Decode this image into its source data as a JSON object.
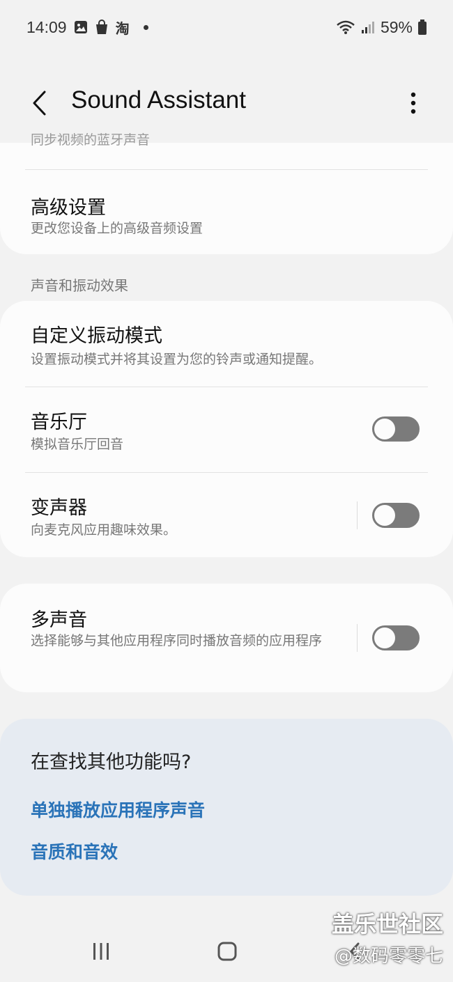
{
  "status": {
    "time": "14:09",
    "taobao_glyph": "淘",
    "battery": "59%",
    "icons": [
      "gallery-icon",
      "shopping-bag-icon",
      "taobao-icon",
      "wifi-icon",
      "signal-icon",
      "battery-icon"
    ]
  },
  "header": {
    "title": "Sound Assistant",
    "back_icon": "chevron-left-icon",
    "more_icon": "more-vert-icon"
  },
  "top_card": {
    "partial_row_sub": "同步视频的蓝牙声音",
    "advanced_title": "高级设置",
    "advanced_sub": "更改您设备上的高级音频设置"
  },
  "section_effects": {
    "header": "声音和振动效果",
    "items": [
      {
        "title": "自定义振动模式",
        "subtitle": "设置振动模式并将其设置为您的铃声或通知提醒。"
      },
      {
        "title": "音乐厅",
        "subtitle": "模拟音乐厅回音",
        "toggle": false
      },
      {
        "title": "变声器",
        "subtitle": "向麦克风应用趣味效果。",
        "toggle": false
      }
    ]
  },
  "multi_sound": {
    "title": "多声音",
    "subtitle": "选择能够与其他应用程序同时播放音频的应用程序",
    "toggle": false
  },
  "suggestions": {
    "title": "在查找其他功能吗?",
    "links": [
      "单独播放应用程序声音",
      "音质和音效"
    ]
  },
  "watermark": {
    "line1": "盖乐世社区",
    "line2": "@数码零零七"
  },
  "colors": {
    "background": "#f2f2f2",
    "card": "#fcfcfc",
    "suggest_card": "#e6ebf2",
    "link": "#2a73b8",
    "toggle_off": "#7b7b7b"
  }
}
